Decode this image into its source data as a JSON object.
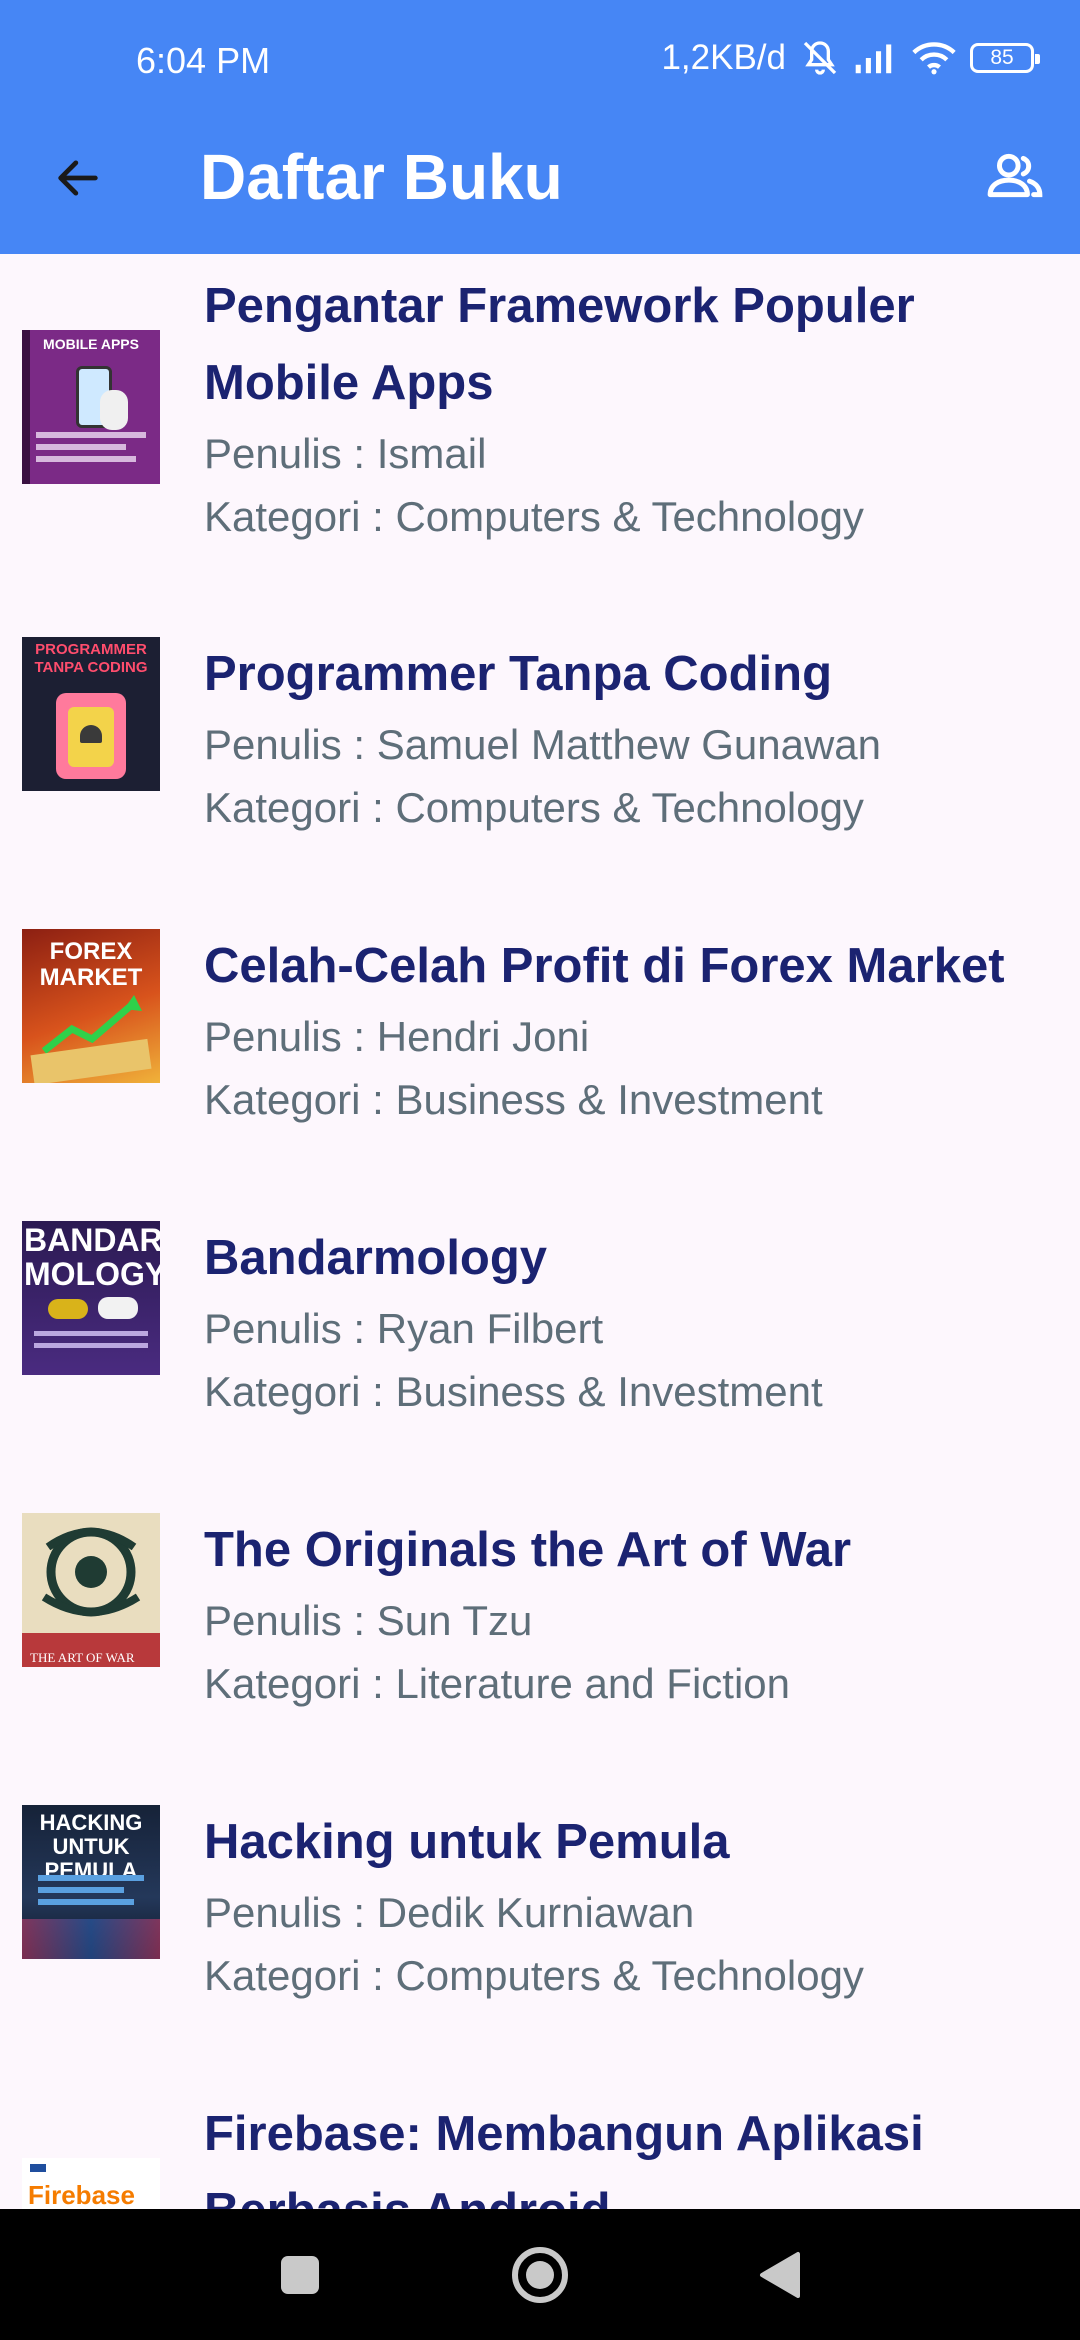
{
  "status_bar": {
    "time": "6:04 PM",
    "network_speed": "1,2KB/d",
    "battery": "85",
    "icons": [
      "bell-muted-icon",
      "signal-icon",
      "wifi-icon",
      "battery-icon"
    ]
  },
  "app_bar": {
    "title": "Daftar Buku",
    "back_icon": "arrow-left-icon",
    "action_icon": "people-icon"
  },
  "books": [
    {
      "title": "Pengantar Framework Populer Mobile Apps",
      "author": "Penulis : Ismail",
      "category": "Kategori : Computers & Technology",
      "cover": {
        "text": "MOBILE APPS",
        "bg": "#7B2A86",
        "fg": "#FFFFFF"
      }
    },
    {
      "title": "Programmer Tanpa Coding",
      "author": "Penulis : Samuel Matthew Gunawan",
      "category": "Kategori : Computers & Technology",
      "cover": {
        "text": "PROGRAMMER TANPA CODING",
        "bg": "#1C1F33",
        "fg": "#FF4D6D"
      }
    },
    {
      "title": "Celah-Celah Profit di Forex Market",
      "author": "Penulis : Hendri Joni",
      "category": "Kategori : Business & Investment",
      "cover": {
        "text": "FOREX MARKET",
        "bg": "#B5331A",
        "fg": "#FFFFFF"
      }
    },
    {
      "title": "Bandarmology",
      "author": "Penulis : Ryan Filbert",
      "category": "Kategori : Business & Investment",
      "cover": {
        "text": "BANDAR MOLOGY",
        "bg": "#3A2466",
        "fg": "#FFFFFF"
      }
    },
    {
      "title": "The Originals the Art of War",
      "author": "Penulis : Sun Tzu",
      "category": "Kategori : Literature and Fiction",
      "cover": {
        "text": "THE ART OF WAR",
        "bg": "#E9DDBF",
        "fg": "#FFFFFF"
      }
    },
    {
      "title": "Hacking untuk Pemula",
      "author": "Penulis : Dedik Kurniawan",
      "category": "Kategori : Computers & Technology",
      "cover": {
        "text": "HACKING UNTUK PEMULA",
        "bg": "#162238",
        "fg": "#FFFFFF"
      }
    },
    {
      "title": "Firebase: Membangun Aplikasi Berbasis Android",
      "author": "",
      "category": "",
      "cover": {
        "text": "Firebase",
        "bg": "#FFFFFF",
        "fg": "#F57C00"
      }
    }
  ],
  "nav_bar": {
    "buttons": [
      "recents-square-icon",
      "home-circle-icon",
      "back-triangle-icon"
    ]
  },
  "colors": {
    "app_bar": "#4686F5",
    "title_text": "#1B2371",
    "meta_text": "#5E6E79",
    "background": "#FDF7FD"
  }
}
